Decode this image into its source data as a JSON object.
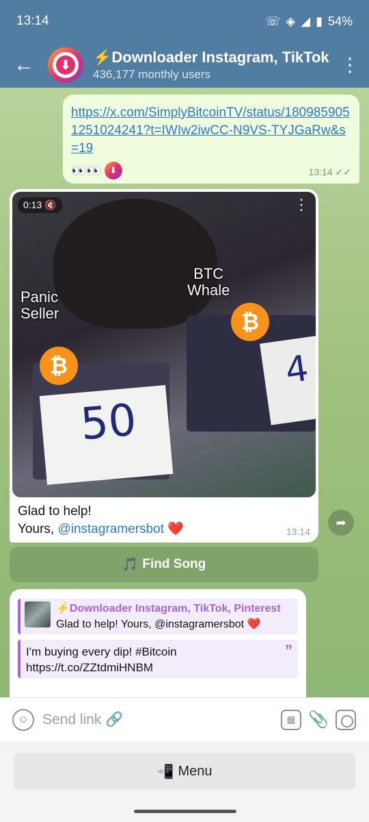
{
  "status_bar": {
    "time": "13:14",
    "battery": "54%"
  },
  "header": {
    "back_icon": "arrow-left-icon",
    "title": "⚡Downloader Instagram, TikTok",
    "subtitle": "436,177 monthly users",
    "menu_icon": "more-vert-icon"
  },
  "messages": {
    "outgoing": {
      "link": "https://x.com/SimplyBitcoinTV/status/1809859051251024241?t=IWIw2iwCC-N9VS-TYJGaRw&s=19",
      "reaction_emoji": "👀👀",
      "time": "13:14"
    },
    "incoming_video": {
      "duration": "0:13",
      "caption_left": "Panic\nSeller",
      "caption_right": "BTC\nWhale",
      "text_line1": "Glad to help!",
      "text_prefix": "Yours, ",
      "mention": "@instagramersbot",
      "heart": "❤️",
      "time": "13:14"
    },
    "find_song": {
      "icon": "🎵",
      "label": "Find Song"
    },
    "incoming_reply": {
      "reply_name": "⚡Downloader Instagram, TikTok, Pinterest",
      "reply_text": "Glad to help! Yours, @instagramersbot ❤️",
      "quote_text": "I'm buying every dip! #Bitcoin  https://t.co/ZZtdmiHNBM"
    }
  },
  "input_bar": {
    "placeholder": "Send link 🔗"
  },
  "menu_button": {
    "icon": "📲",
    "label": "Menu"
  },
  "colors": {
    "header": "#517da2",
    "link": "#2d79c4",
    "accent_purple": "#a863d6"
  }
}
